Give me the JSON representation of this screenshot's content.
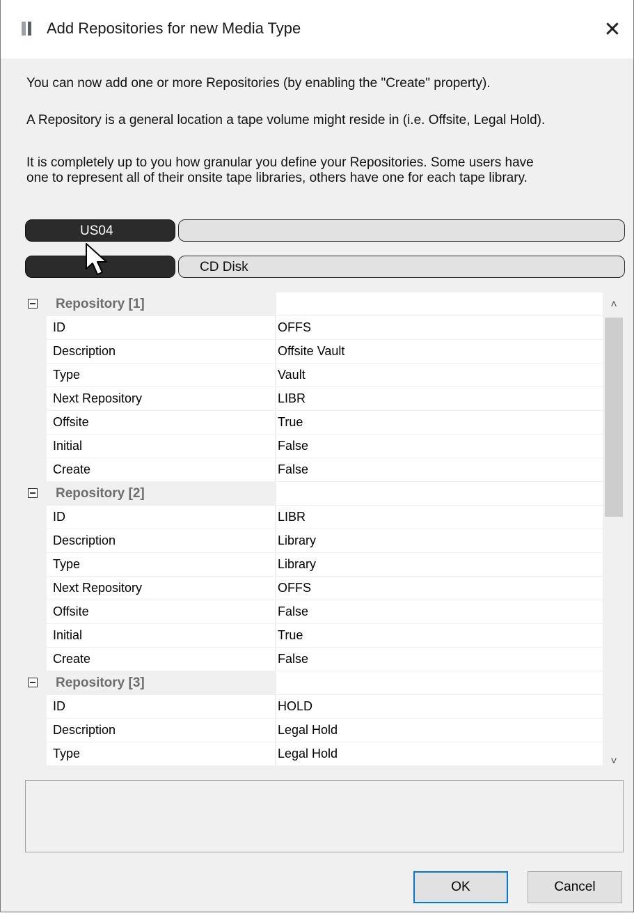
{
  "window": {
    "title": "Add Repositories for new Media Type",
    "close_glyph": "✕"
  },
  "intro": {
    "line1": "You can now add one or more Repositories (by enabling the \"Create\" property).",
    "line2": "A Repository is a general location a tape volume might reside in (i.e. Offsite, Legal Hold).",
    "line3a": "It is completely up to you how granular you define your Repositories. Some users have",
    "line3b": "one to represent all of their onsite tape libraries, others have one for each tape library."
  },
  "selector_rows": [
    {
      "left": "US04",
      "right": ""
    },
    {
      "left": "",
      "right": "CD Disk"
    }
  ],
  "grid": {
    "categories": [
      {
        "label": "Repository [1]",
        "properties": [
          {
            "name": "ID",
            "value": "OFFS"
          },
          {
            "name": "Description",
            "value": "Offsite Vault"
          },
          {
            "name": "Type",
            "value": "Vault"
          },
          {
            "name": "Next Repository",
            "value": "LIBR"
          },
          {
            "name": "Offsite",
            "value": "True"
          },
          {
            "name": "Initial",
            "value": "False"
          },
          {
            "name": "Create",
            "value": "False"
          }
        ]
      },
      {
        "label": "Repository [2]",
        "properties": [
          {
            "name": "ID",
            "value": "LIBR"
          },
          {
            "name": "Description",
            "value": "Library"
          },
          {
            "name": "Type",
            "value": "Library"
          },
          {
            "name": "Next Repository",
            "value": "OFFS"
          },
          {
            "name": "Offsite",
            "value": "False"
          },
          {
            "name": "Initial",
            "value": "True"
          },
          {
            "name": "Create",
            "value": "False"
          }
        ]
      },
      {
        "label": "Repository [3]",
        "properties": [
          {
            "name": "ID",
            "value": "HOLD"
          },
          {
            "name": "Description",
            "value": "Legal Hold"
          },
          {
            "name": "Type",
            "value": "Legal Hold"
          }
        ]
      }
    ],
    "scroll_up_glyph": "˄",
    "scroll_down_glyph": "˅"
  },
  "buttons": {
    "ok": "OK",
    "cancel": "Cancel"
  },
  "icons": {
    "app": "app-icon",
    "collapse": "minus-box-icon",
    "cursor": "mouse-pointer-icon"
  },
  "colors": {
    "accent": "#0078d7",
    "dark_pill": "#2b2b2b",
    "category_text": "#6d6d6d"
  }
}
